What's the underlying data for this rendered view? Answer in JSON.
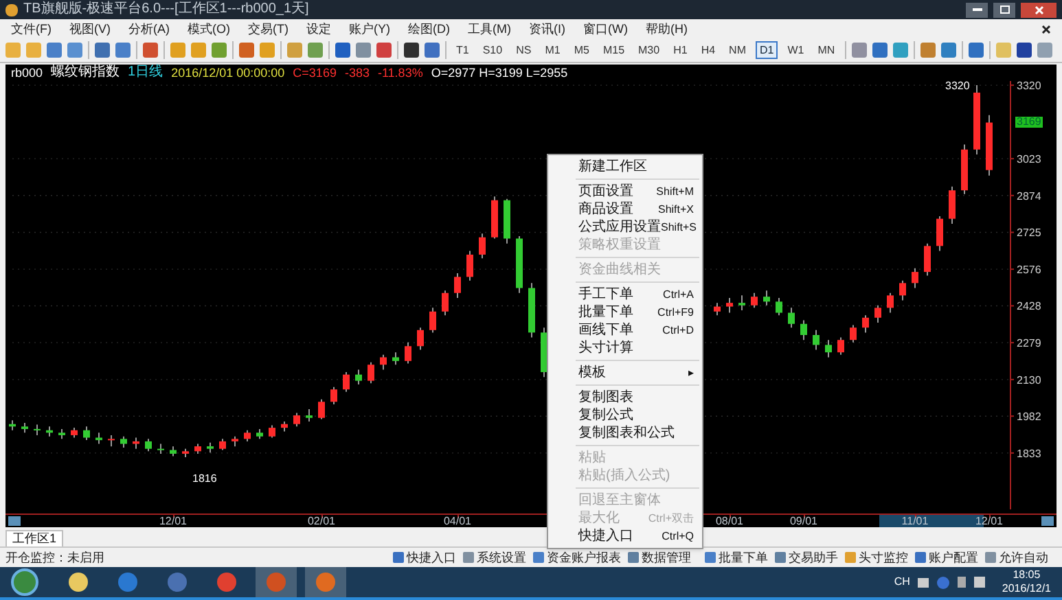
{
  "window": {
    "title": "TB旗舰版-极速平台6.0---[工作区1---rb000_1天]"
  },
  "menu_bar": [
    "文件(F)",
    "视图(V)",
    "分析(A)",
    "模式(O)",
    "交易(T)",
    "设定",
    "账户(Y)",
    "绘图(D)",
    "工具(M)",
    "资讯(I)",
    "窗口(W)",
    "帮助(H)"
  ],
  "timeframes": [
    {
      "label": "T1",
      "selected": false
    },
    {
      "label": "S10",
      "selected": false
    },
    {
      "label": "NS",
      "selected": false
    },
    {
      "label": "M1",
      "selected": false
    },
    {
      "label": "M5",
      "selected": false
    },
    {
      "label": "M15",
      "selected": false
    },
    {
      "label": "M30",
      "selected": false
    },
    {
      "label": "H1",
      "selected": false
    },
    {
      "label": "H4",
      "selected": false
    },
    {
      "label": "NM",
      "selected": false
    },
    {
      "label": "D1",
      "selected": true
    },
    {
      "label": "W1",
      "selected": false
    },
    {
      "label": "MN",
      "selected": false
    }
  ],
  "chart_header": {
    "symbol": "rb000",
    "name": "螺纹钢指数",
    "period": "1日线",
    "datetime": "2016/12/01 00:00:00",
    "close": "C=3169",
    "change": "-383",
    "change_pct": "-11.83%",
    "ohlc": "O=2977 H=3199 L=2955"
  },
  "chart": {
    "last_price": "3169",
    "high_label": "3320",
    "low_label": "1816",
    "chart_data": {
      "type": "candlestick",
      "grid": true,
      "ylim": [
        1605,
        3337
      ],
      "categories": [
        null,
        null,
        null,
        null,
        null,
        null,
        null,
        null,
        null,
        null,
        null,
        null,
        null,
        "12/01",
        null,
        null,
        null,
        null,
        null,
        null,
        null,
        null,
        null,
        null,
        null,
        "02/01",
        null,
        null,
        null,
        null,
        null,
        null,
        null,
        null,
        null,
        null,
        "04/01",
        null,
        null,
        null,
        null,
        null,
        null,
        null,
        null,
        null,
        null,
        null,
        null,
        null,
        null,
        null,
        null,
        null,
        null,
        null,
        null,
        null,
        "08/01",
        null,
        null,
        null,
        null,
        null,
        "09/01",
        null,
        null,
        null,
        null,
        null,
        null,
        null,
        null,
        "11/01",
        null,
        null,
        null,
        null,
        null,
        "12/01"
      ],
      "yticks": [
        3320,
        3023,
        2874,
        2725,
        2576,
        2428,
        2279,
        2130,
        1982,
        1833
      ],
      "ohlc": [
        [
          1950,
          1965,
          1925,
          1940
        ],
        [
          1940,
          1955,
          1915,
          1930
        ],
        [
          1930,
          1948,
          1905,
          1925
        ],
        [
          1925,
          1940,
          1900,
          1915
        ],
        [
          1915,
          1930,
          1890,
          1905
        ],
        [
          1905,
          1935,
          1895,
          1925
        ],
        [
          1925,
          1940,
          1885,
          1895
        ],
        [
          1895,
          1915,
          1870,
          1885
        ],
        [
          1885,
          1905,
          1860,
          1890
        ],
        [
          1890,
          1900,
          1855,
          1870
        ],
        [
          1870,
          1895,
          1850,
          1880
        ],
        [
          1880,
          1890,
          1840,
          1850
        ],
        [
          1850,
          1870,
          1830,
          1845
        ],
        [
          1845,
          1860,
          1820,
          1830
        ],
        [
          1830,
          1850,
          1816,
          1840
        ],
        [
          1840,
          1870,
          1830,
          1860
        ],
        [
          1860,
          1875,
          1835,
          1850
        ],
        [
          1850,
          1890,
          1845,
          1880
        ],
        [
          1880,
          1900,
          1860,
          1890
        ],
        [
          1890,
          1925,
          1880,
          1915
        ],
        [
          1915,
          1930,
          1890,
          1900
        ],
        [
          1900,
          1945,
          1895,
          1935
        ],
        [
          1935,
          1960,
          1920,
          1950
        ],
        [
          1950,
          1995,
          1940,
          1985
        ],
        [
          1985,
          2010,
          1960,
          1975
        ],
        [
          1975,
          2050,
          1970,
          2040
        ],
        [
          2040,
          2100,
          2030,
          2090
        ],
        [
          2090,
          2160,
          2080,
          2150
        ],
        [
          2150,
          2170,
          2110,
          2125
        ],
        [
          2125,
          2200,
          2115,
          2190
        ],
        [
          2190,
          2230,
          2170,
          2220
        ],
        [
          2220,
          2240,
          2190,
          2205
        ],
        [
          2205,
          2280,
          2195,
          2265
        ],
        [
          2265,
          2340,
          2250,
          2330
        ],
        [
          2330,
          2420,
          2320,
          2405
        ],
        [
          2405,
          2490,
          2390,
          2480
        ],
        [
          2480,
          2560,
          2460,
          2545
        ],
        [
          2545,
          2650,
          2530,
          2635
        ],
        [
          2635,
          2720,
          2620,
          2705
        ],
        [
          2705,
          2870,
          2700,
          2855
        ],
        [
          2855,
          2860,
          2680,
          2700
        ],
        [
          2700,
          2710,
          2480,
          2500
        ],
        [
          2500,
          2520,
          2300,
          2320
        ],
        [
          2320,
          2340,
          2140,
          2160
        ],
        null,
        null,
        null,
        null,
        null,
        null,
        null,
        null,
        null,
        null,
        null,
        null,
        null,
        [
          2405,
          2440,
          2390,
          2425
        ],
        [
          2425,
          2460,
          2400,
          2440
        ],
        [
          2440,
          2470,
          2410,
          2430
        ],
        [
          2430,
          2480,
          2420,
          2465
        ],
        [
          2465,
          2490,
          2430,
          2445
        ],
        [
          2445,
          2460,
          2390,
          2400
        ],
        [
          2400,
          2420,
          2340,
          2355
        ],
        [
          2355,
          2370,
          2290,
          2310
        ],
        [
          2310,
          2330,
          2250,
          2270
        ],
        [
          2270,
          2290,
          2220,
          2240
        ],
        [
          2240,
          2300,
          2230,
          2290
        ],
        [
          2290,
          2350,
          2280,
          2340
        ],
        [
          2340,
          2390,
          2320,
          2380
        ],
        [
          2380,
          2430,
          2360,
          2420
        ],
        [
          2420,
          2480,
          2400,
          2470
        ],
        [
          2470,
          2530,
          2450,
          2520
        ],
        [
          2520,
          2580,
          2500,
          2565
        ],
        [
          2565,
          2680,
          2550,
          2670
        ],
        [
          2670,
          2790,
          2650,
          2780
        ],
        [
          2780,
          2910,
          2760,
          2895
        ],
        [
          2895,
          3080,
          2880,
          3060
        ],
        [
          3060,
          3320,
          3040,
          3290
        ],
        [
          2977,
          3199,
          2955,
          3169
        ]
      ]
    }
  },
  "workspace_tabs": [
    {
      "label": "工作区1",
      "selected": true
    }
  ],
  "status_bar": {
    "text": "开仓监控：未启用",
    "shortcuts_left": [
      "快捷入口",
      "系统设置",
      "资金账户报表",
      "数据管理"
    ],
    "shortcuts_right": [
      "批量下单",
      "交易助手",
      "头寸监控",
      "账户配置",
      "允许自动"
    ]
  },
  "context_menu": [
    {
      "kind": "item",
      "label": "新建工作区",
      "disabled": false
    },
    {
      "kind": "separator"
    },
    {
      "kind": "item",
      "label": "页面设置",
      "shortcut": "Shift+M",
      "disabled": false
    },
    {
      "kind": "item",
      "label": "商品设置",
      "shortcut": "Shift+X",
      "disabled": false
    },
    {
      "kind": "item",
      "label": "公式应用设置",
      "shortcut": "Shift+S",
      "disabled": false
    },
    {
      "kind": "item",
      "label": "策略权重设置",
      "disabled": true
    },
    {
      "kind": "separator"
    },
    {
      "kind": "item",
      "label": "资金曲线相关",
      "disabled": true
    },
    {
      "kind": "separator"
    },
    {
      "kind": "item",
      "label": "手工下单",
      "shortcut": "Ctrl+A",
      "disabled": false
    },
    {
      "kind": "item",
      "label": "批量下单",
      "shortcut": "Ctrl+F9",
      "disabled": false
    },
    {
      "kind": "item",
      "label": "画线下单",
      "shortcut": "Ctrl+D",
      "disabled": false
    },
    {
      "kind": "item",
      "label": "头寸计算",
      "disabled": false
    },
    {
      "kind": "separator"
    },
    {
      "kind": "submenu",
      "label": "模板",
      "arrow": "▸",
      "disabled": false
    },
    {
      "kind": "separator"
    },
    {
      "kind": "item",
      "label": "复制图表",
      "disabled": false
    },
    {
      "kind": "item",
      "label": "复制公式",
      "disabled": false
    },
    {
      "kind": "item",
      "label": "复制图表和公式",
      "disabled": false
    },
    {
      "kind": "separator"
    },
    {
      "kind": "item",
      "label": "粘贴",
      "disabled": true
    },
    {
      "kind": "item",
      "label": "粘贴(插入公式)",
      "disabled": true
    },
    {
      "kind": "separator"
    },
    {
      "kind": "item",
      "label": "回退至主窗体",
      "disabled": true
    },
    {
      "kind": "item",
      "label": "最大化",
      "shortcut": "Ctrl+双击",
      "disabled": true
    },
    {
      "kind": "item",
      "label": "快捷入口",
      "shortcut": "Ctrl+Q",
      "disabled": false
    }
  ],
  "taskbar": {
    "language": "CH",
    "time": "18:05",
    "date": "2016/12/1"
  }
}
